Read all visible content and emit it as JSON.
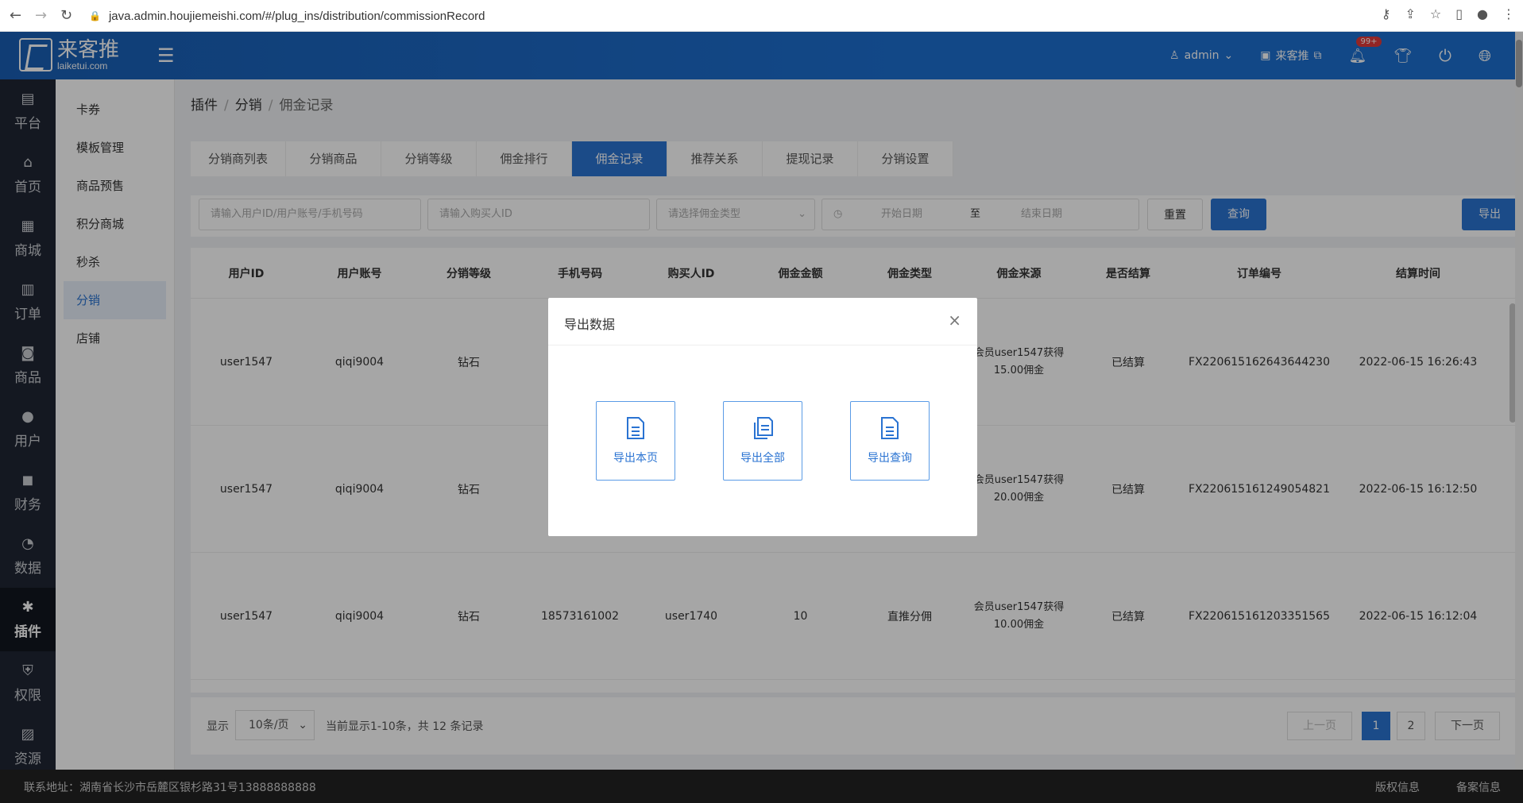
{
  "browser": {
    "url": "java.admin.houjiemeishi.com/#/plug_ins/distribution/commissionRecord"
  },
  "header": {
    "brand_cn": "来客推",
    "brand_en": "laiketui.com",
    "user": "admin",
    "store": "来客推",
    "notification_badge": "99+"
  },
  "leftbar": [
    {
      "icon": "platform-icon",
      "label": "平台"
    },
    {
      "icon": "home-icon",
      "label": "首页"
    },
    {
      "icon": "mall-icon",
      "label": "商城"
    },
    {
      "icon": "order-icon",
      "label": "订单"
    },
    {
      "icon": "goods-icon",
      "label": "商品"
    },
    {
      "icon": "user-icon",
      "label": "用户"
    },
    {
      "icon": "finance-icon",
      "label": "财务"
    },
    {
      "icon": "data-icon",
      "label": "数据"
    },
    {
      "icon": "plugin-icon",
      "label": "插件"
    },
    {
      "icon": "permission-icon",
      "label": "权限"
    },
    {
      "icon": "resource-icon",
      "label": "资源"
    }
  ],
  "submenu": [
    "卡券",
    "模板管理",
    "商品预售",
    "积分商城",
    "秒杀",
    "分销",
    "店铺"
  ],
  "breadcrumb": [
    "插件",
    "分销",
    "佣金记录"
  ],
  "tabs": [
    "分销商列表",
    "分销商品",
    "分销等级",
    "佣金排行",
    "佣金记录",
    "推荐关系",
    "提现记录",
    "分销设置"
  ],
  "filters": {
    "user_placeholder": "请输入用户ID/用户账号/手机号码",
    "buyer_placeholder": "请输入购买人ID",
    "type_placeholder": "请选择佣金类型",
    "start_placeholder": "开始日期",
    "to": "至",
    "end_placeholder": "结束日期",
    "reset": "重置",
    "query": "查询",
    "export": "导出"
  },
  "table": {
    "headers": [
      "用户ID",
      "用户账号",
      "分销等级",
      "手机号码",
      "购买人ID",
      "佣金金额",
      "佣金类型",
      "佣金来源",
      "是否结算",
      "订单编号",
      "结算时间"
    ],
    "rows": [
      [
        "user1547",
        "qiqi9004",
        "钻石",
        "",
        "",
        "",
        "",
        "会员user1547获得\n15.00佣金",
        "已结算",
        "FX220615162643644230",
        "2022-06-15 16:26:43"
      ],
      [
        "user1547",
        "qiqi9004",
        "钻石",
        "",
        "",
        "",
        "",
        "会员user1547获得\n20.00佣金",
        "已结算",
        "FX220615161249054821",
        "2022-06-15 16:12:50"
      ],
      [
        "user1547",
        "qiqi9004",
        "钻石",
        "18573161002",
        "user1740",
        "10",
        "直推分佣",
        "会员user1547获得\n10.00佣金",
        "已结算",
        "FX220615161203351565",
        "2022-06-15 16:12:04"
      ]
    ]
  },
  "pager": {
    "show": "显示",
    "page_size": "10条/页",
    "summary": "当前显示1-10条，共 12 条记录",
    "prev": "上一页",
    "pages": [
      "1",
      "2"
    ],
    "next": "下一页"
  },
  "footer": {
    "address": "联系地址：湖南省长沙市岳麓区银杉路31号13888888888",
    "copyright": "版权信息",
    "record": "备案信息"
  },
  "modal": {
    "title": "导出数据",
    "options": [
      "导出本页",
      "导出全部",
      "导出查询"
    ]
  }
}
